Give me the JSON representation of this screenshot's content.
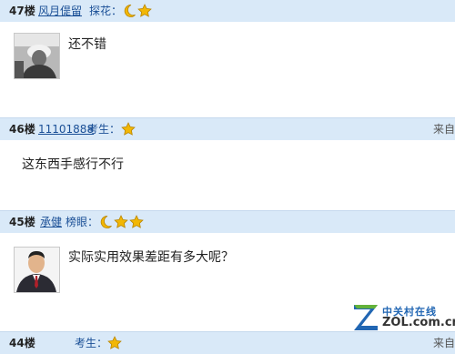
{
  "posts": [
    {
      "floor": "47楼",
      "user": "风月偍留",
      "title": "探花：",
      "badges": [
        "moon-icon",
        "star-icon"
      ],
      "avatar": "avatar-photo-bw",
      "message": "还不错",
      "from": ""
    },
    {
      "floor": "46楼",
      "user": "11101888",
      "title": "考生：",
      "badges": [
        "star-icon"
      ],
      "avatar": "",
      "message": "这东西手感行不行",
      "from": "来自"
    },
    {
      "floor": "45楼",
      "user": "承健",
      "title": "榜眼：",
      "badges": [
        "moon-icon",
        "star-icon",
        "star-icon"
      ],
      "avatar": "avatar-photo-man-suit",
      "message": "实际实用效果差距有多大呢？",
      "from": ""
    },
    {
      "floor": "44楼",
      "user": "",
      "title": "考生：",
      "badges": [
        "star-icon"
      ],
      "avatar": "",
      "message": "",
      "from": "来自"
    }
  ],
  "watermark": {
    "cn": "中关村在线",
    "en": "ZOL.com.cn"
  },
  "colors": {
    "header_bg": "#d9e9f8",
    "link": "#1a4f96",
    "moon": "#f2b705",
    "star": "#f2b705"
  }
}
